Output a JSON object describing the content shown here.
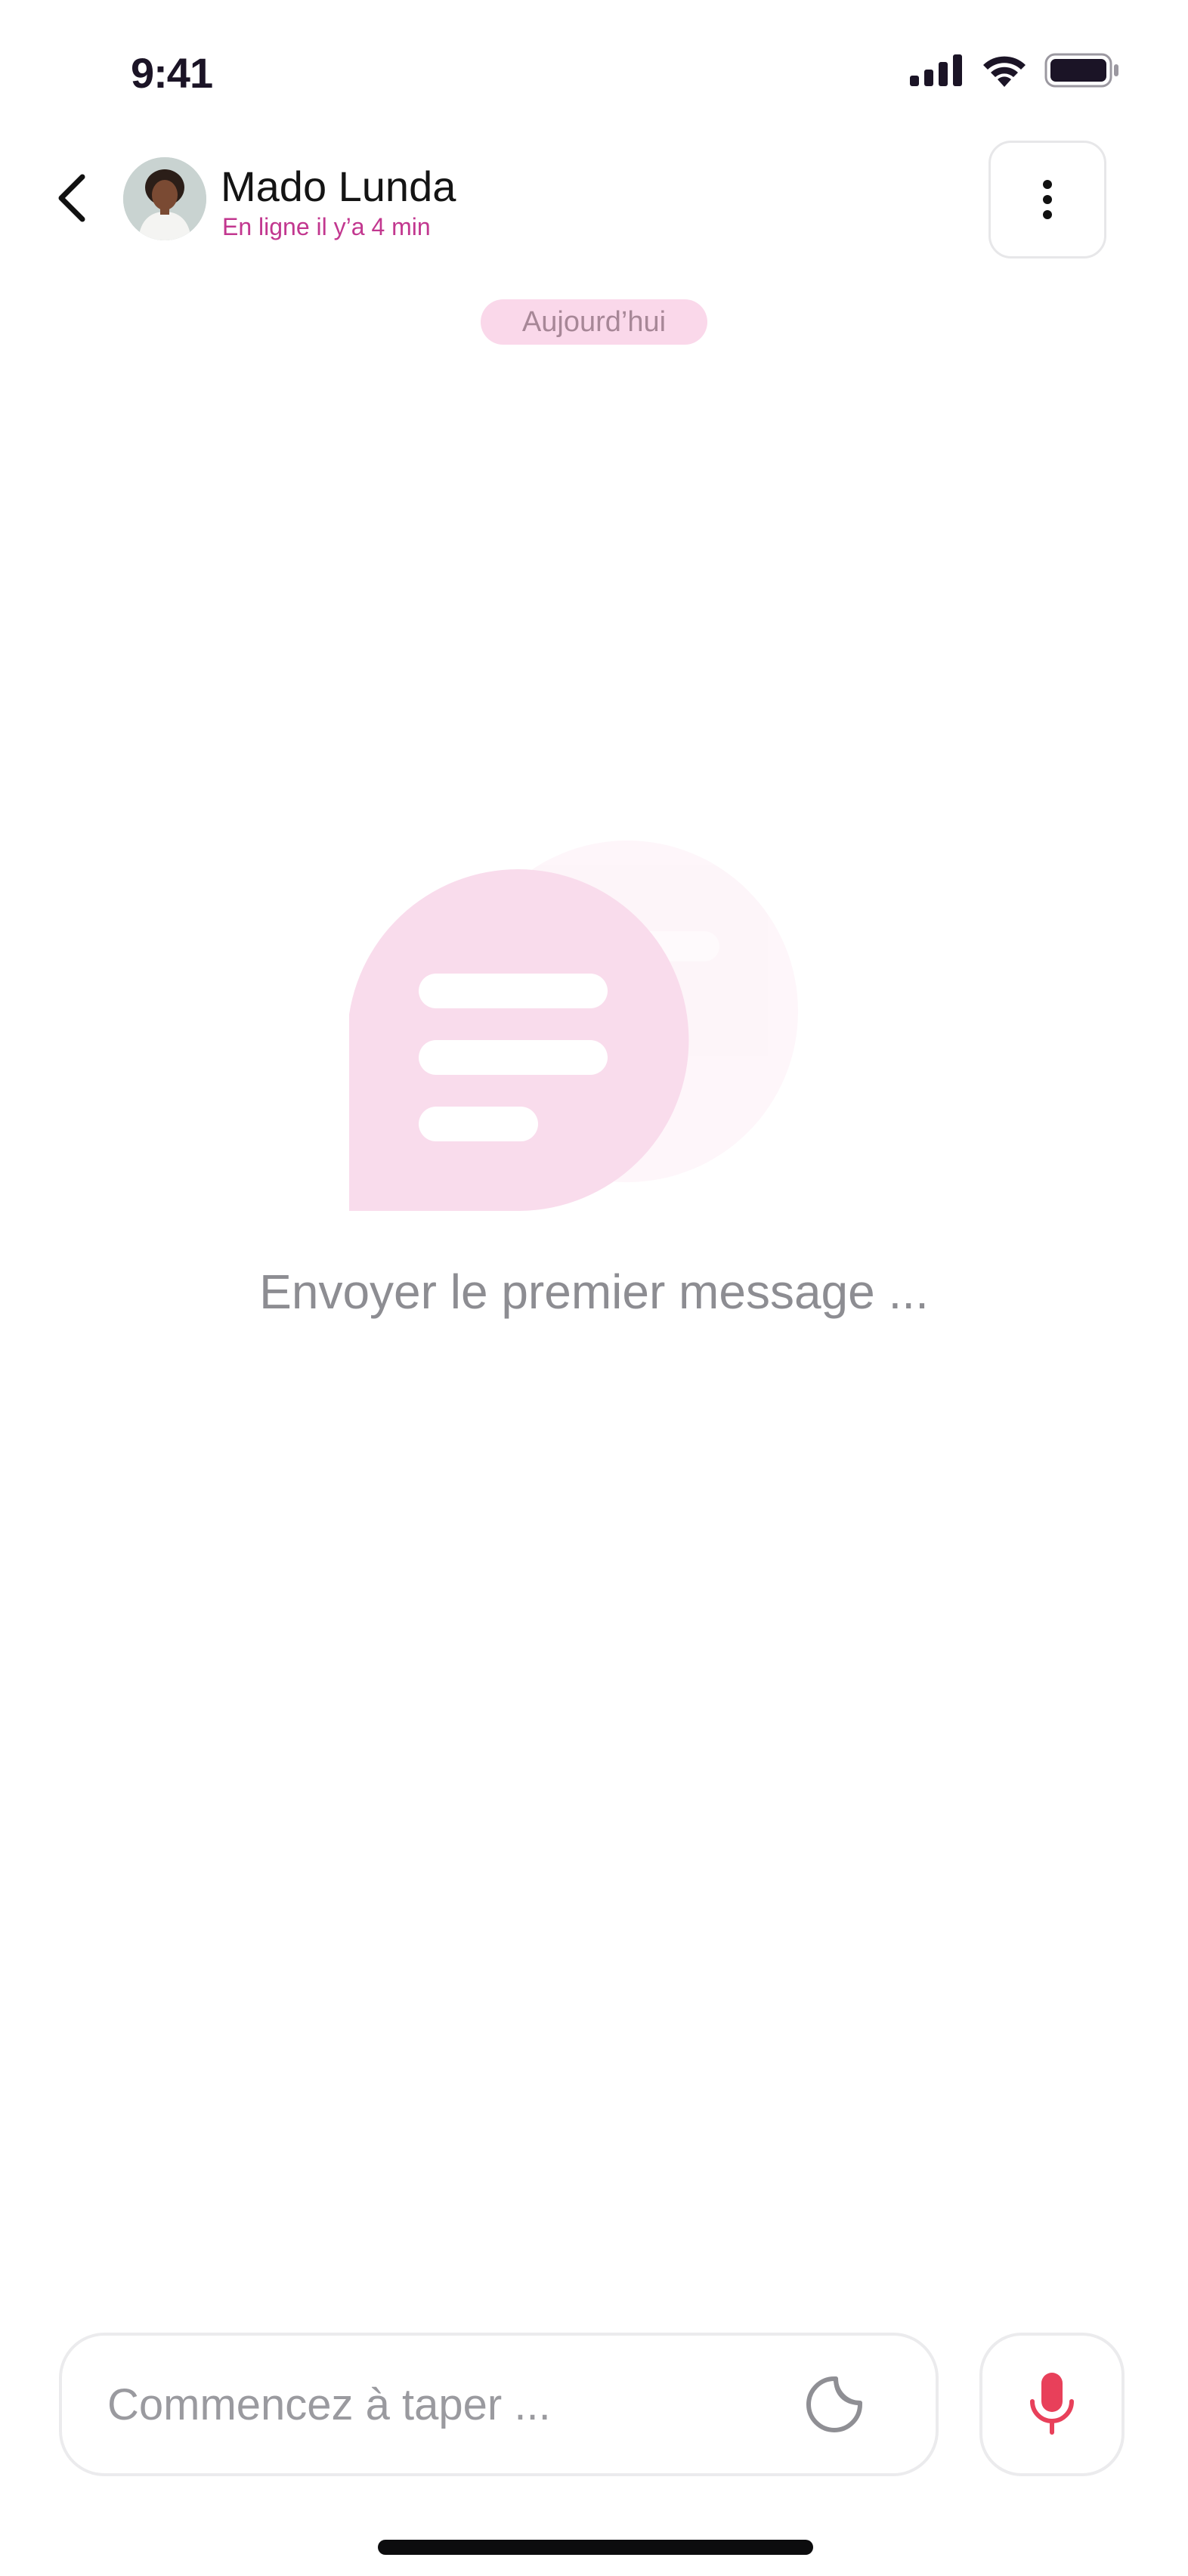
{
  "status_bar": {
    "time": "9:41",
    "icons": [
      "cellular-signal-icon",
      "wifi-icon",
      "battery-icon"
    ]
  },
  "header": {
    "back_icon": "chevron-left-icon",
    "avatar_alt": "Mado Lunda",
    "contact_name": "Mado Lunda",
    "contact_status": "En ligne il y’a 4 min",
    "menu_icon": "vertical-dots-icon"
  },
  "chat": {
    "date_label": "Aujourd’hui",
    "empty_state": {
      "icon": "chat-bubble-icon",
      "message": "Envoyer le premier message ..."
    }
  },
  "composer": {
    "placeholder": "Commencez à taper ...",
    "value": "",
    "sticker_icon": "sticker-icon",
    "mic_icon": "microphone-icon"
  },
  "colors": {
    "accent": "#c2378f",
    "chip_bg": "#fad8ea",
    "illustration_pink": "#f9dcec",
    "mic_red": "#e8405a"
  }
}
